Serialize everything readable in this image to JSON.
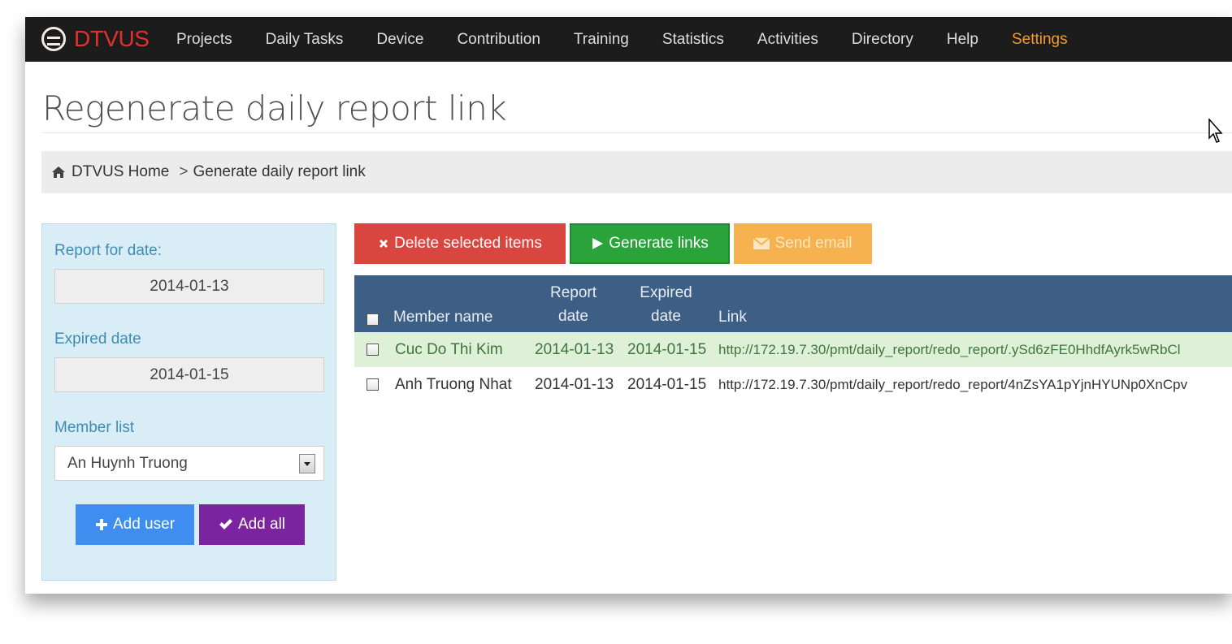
{
  "navbar": {
    "brand": "DTVUS",
    "items": [
      {
        "label": "Projects"
      },
      {
        "label": "Daily Tasks"
      },
      {
        "label": "Device"
      },
      {
        "label": "Contribution"
      },
      {
        "label": "Training"
      },
      {
        "label": "Statistics"
      },
      {
        "label": "Activities"
      },
      {
        "label": "Directory"
      },
      {
        "label": "Help"
      },
      {
        "label": "Settings"
      }
    ],
    "active_color": "#f29a2e",
    "brand_color": "#e4322b"
  },
  "page": {
    "title": "Regenerate daily report link"
  },
  "breadcrumb": {
    "home": "DTVUS Home",
    "separator": ">",
    "current": "Generate daily report link"
  },
  "sidebar": {
    "report_date_label": "Report for date:",
    "report_date_value": "2014-01-13",
    "expired_date_label": "Expired date",
    "expired_date_value": "2014-01-15",
    "member_list_label": "Member list",
    "member_selected": "An Huynh Truong",
    "add_user_label": "Add user",
    "add_all_label": "Add all"
  },
  "toolbar": {
    "delete_label": "Delete selected items",
    "generate_label": "Generate links",
    "send_email_label": "Send email"
  },
  "table": {
    "headers": {
      "member": "Member name",
      "report_date_1": "Report",
      "report_date_2": "date",
      "expired_date_1": "Expired",
      "expired_date_2": "date",
      "link": "Link"
    },
    "rows": [
      {
        "member": "Cuc Do Thi Kim",
        "report_date": "2014-01-13",
        "expired_date": "2014-01-15",
        "link": "http://172.19.7.30/pmt/daily_report/redo_report/.ySd6zFE0HhdfAyrk5wRbCl"
      },
      {
        "member": "Anh Truong Nhat",
        "report_date": "2014-01-13",
        "expired_date": "2014-01-15",
        "link": "http://172.19.7.30/pmt/daily_report/redo_report/4nZsYA1pYjnHYUNp0XnCpv"
      }
    ]
  },
  "colors": {
    "delete": "#d9463f",
    "generate": "#2aa33b",
    "send_email": "#f5b24e",
    "add_user": "#3d8ef0",
    "add_all": "#7b23a1",
    "table_header": "#3d5e85"
  }
}
